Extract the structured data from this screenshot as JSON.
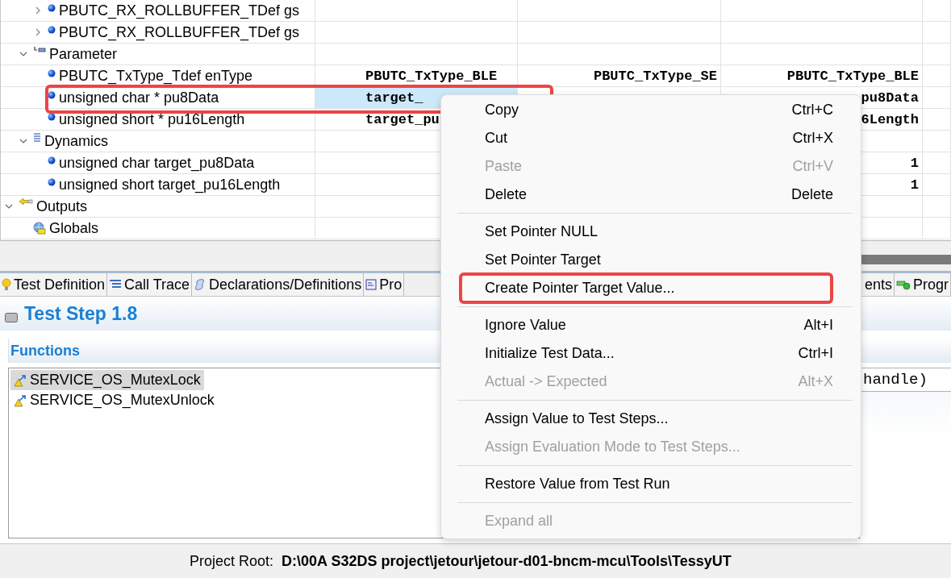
{
  "tree": [
    {
      "children": [
        {
          "children": [
            {
              "label": "PBUTC_RX_ROLLBUFFER_TDef  gs",
              "kind": "dot",
              "expanded": false,
              "selected": false
            },
            {
              "label": "PBUTC_RX_ROLLBUFFER_TDef  gs",
              "kind": "dot",
              "expanded": false,
              "selected": false
            }
          ]
        },
        {
          "label": "Parameter",
          "kind": "parameter",
          "expanded": true,
          "selected": false,
          "children": [
            {
              "label": "PBUTC_TxType_Tdef enType",
              "kind": "dot",
              "selected": false,
              "values": {
                "column_2": "PBUTC_TxType_BLE",
                "column_3": "PBUTC_TxType_SE",
                "column_4": "PBUTC_TxType_BLE"
              }
            },
            {
              "label": "unsigned char * pu8Data",
              "kind": "dot",
              "selected": true,
              "highlighted": true,
              "values": {
                "column_2": "target_",
                "column_4": "pu8Data"
              }
            },
            {
              "label": "unsigned short * pu16Length",
              "kind": "dot",
              "selected": false,
              "values": {
                "column_2": "target_pu",
                "column_4": "6Length"
              }
            }
          ]
        },
        {
          "label": "Dynamics",
          "kind": "dynamics",
          "expanded": true,
          "selected": false,
          "children": [
            {
              "label": "unsigned char target_pu8Data",
              "kind": "dot",
              "selected": false,
              "values": {
                "column_4": "1"
              }
            },
            {
              "label": "unsigned short target_pu16Length",
              "kind": "dot",
              "selected": false,
              "values": {
                "column_4": "1"
              }
            }
          ]
        }
      ]
    },
    {
      "label": "Outputs",
      "kind": "outputs",
      "expanded": true,
      "selected": false,
      "children": [
        {
          "label": "Globals",
          "kind": "globals",
          "selected": false
        }
      ]
    }
  ],
  "tabs": [
    {
      "label": "Test Definition",
      "kind": "bulb",
      "selected": false
    },
    {
      "label": "Call Trace",
      "kind": "trace",
      "selected": false
    },
    {
      "label": "Declarations/Definitions",
      "kind": "script",
      "selected": false
    },
    {
      "label": "Pro",
      "kind": "box",
      "selected": false
    },
    {
      "label": "ents",
      "kind": "none",
      "selected": false
    },
    {
      "label": "Progr",
      "kind": "progress",
      "selected": false
    }
  ],
  "test_step": {
    "title": "Test Step 1.8"
  },
  "functions": {
    "title": "Functions",
    "items": [
      {
        "label": "SERVICE_OS_MutexLock",
        "selected": true
      },
      {
        "label": "SERVICE_OS_MutexUnlock",
        "selected": false
      }
    ],
    "field_value": "handle)"
  },
  "context_menu": [
    {
      "kind": "item",
      "label": "Copy",
      "shortcut": "Ctrl+C",
      "disabled": false,
      "highlighted": false
    },
    {
      "kind": "item",
      "label": "Cut",
      "shortcut": "Ctrl+X",
      "disabled": false,
      "highlighted": false
    },
    {
      "kind": "item",
      "label": "Paste",
      "shortcut": "Ctrl+V",
      "disabled": true,
      "highlighted": false
    },
    {
      "kind": "item",
      "label": "Delete",
      "shortcut": "Delete",
      "disabled": false,
      "highlighted": false
    },
    {
      "kind": "separator"
    },
    {
      "kind": "item",
      "label": "Set Pointer NULL",
      "disabled": false,
      "highlighted": false
    },
    {
      "kind": "item",
      "label": "Set Pointer Target",
      "disabled": false,
      "highlighted": false
    },
    {
      "kind": "item",
      "label": "Create Pointer Target Value...",
      "disabled": false,
      "highlighted": true
    },
    {
      "kind": "separator"
    },
    {
      "kind": "item",
      "label": "Ignore Value",
      "shortcut": "Alt+I",
      "disabled": false,
      "highlighted": false
    },
    {
      "kind": "item",
      "label": "Initialize Test Data...",
      "shortcut": "Ctrl+I",
      "disabled": false,
      "highlighted": false
    },
    {
      "kind": "item",
      "label": "Actual -> Expected",
      "shortcut": "Alt+X",
      "disabled": true,
      "highlighted": false
    },
    {
      "kind": "separator"
    },
    {
      "kind": "item",
      "label": "Assign Value to Test Steps...",
      "disabled": false,
      "highlighted": false
    },
    {
      "kind": "item",
      "label": "Assign Evaluation Mode to Test Steps...",
      "disabled": true,
      "highlighted": false
    },
    {
      "kind": "separator"
    },
    {
      "kind": "item",
      "label": "Restore Value from Test Run",
      "disabled": false,
      "highlighted": false
    },
    {
      "kind": "separator"
    },
    {
      "kind": "item",
      "label": "Expand all",
      "disabled": true,
      "highlighted": false
    }
  ],
  "status_bar": {
    "label": "Project Root:",
    "value": "D:\\00A S32DS project\\jetour\\jetour-d01-bncm-mcu\\Tools\\TessyUT"
  }
}
